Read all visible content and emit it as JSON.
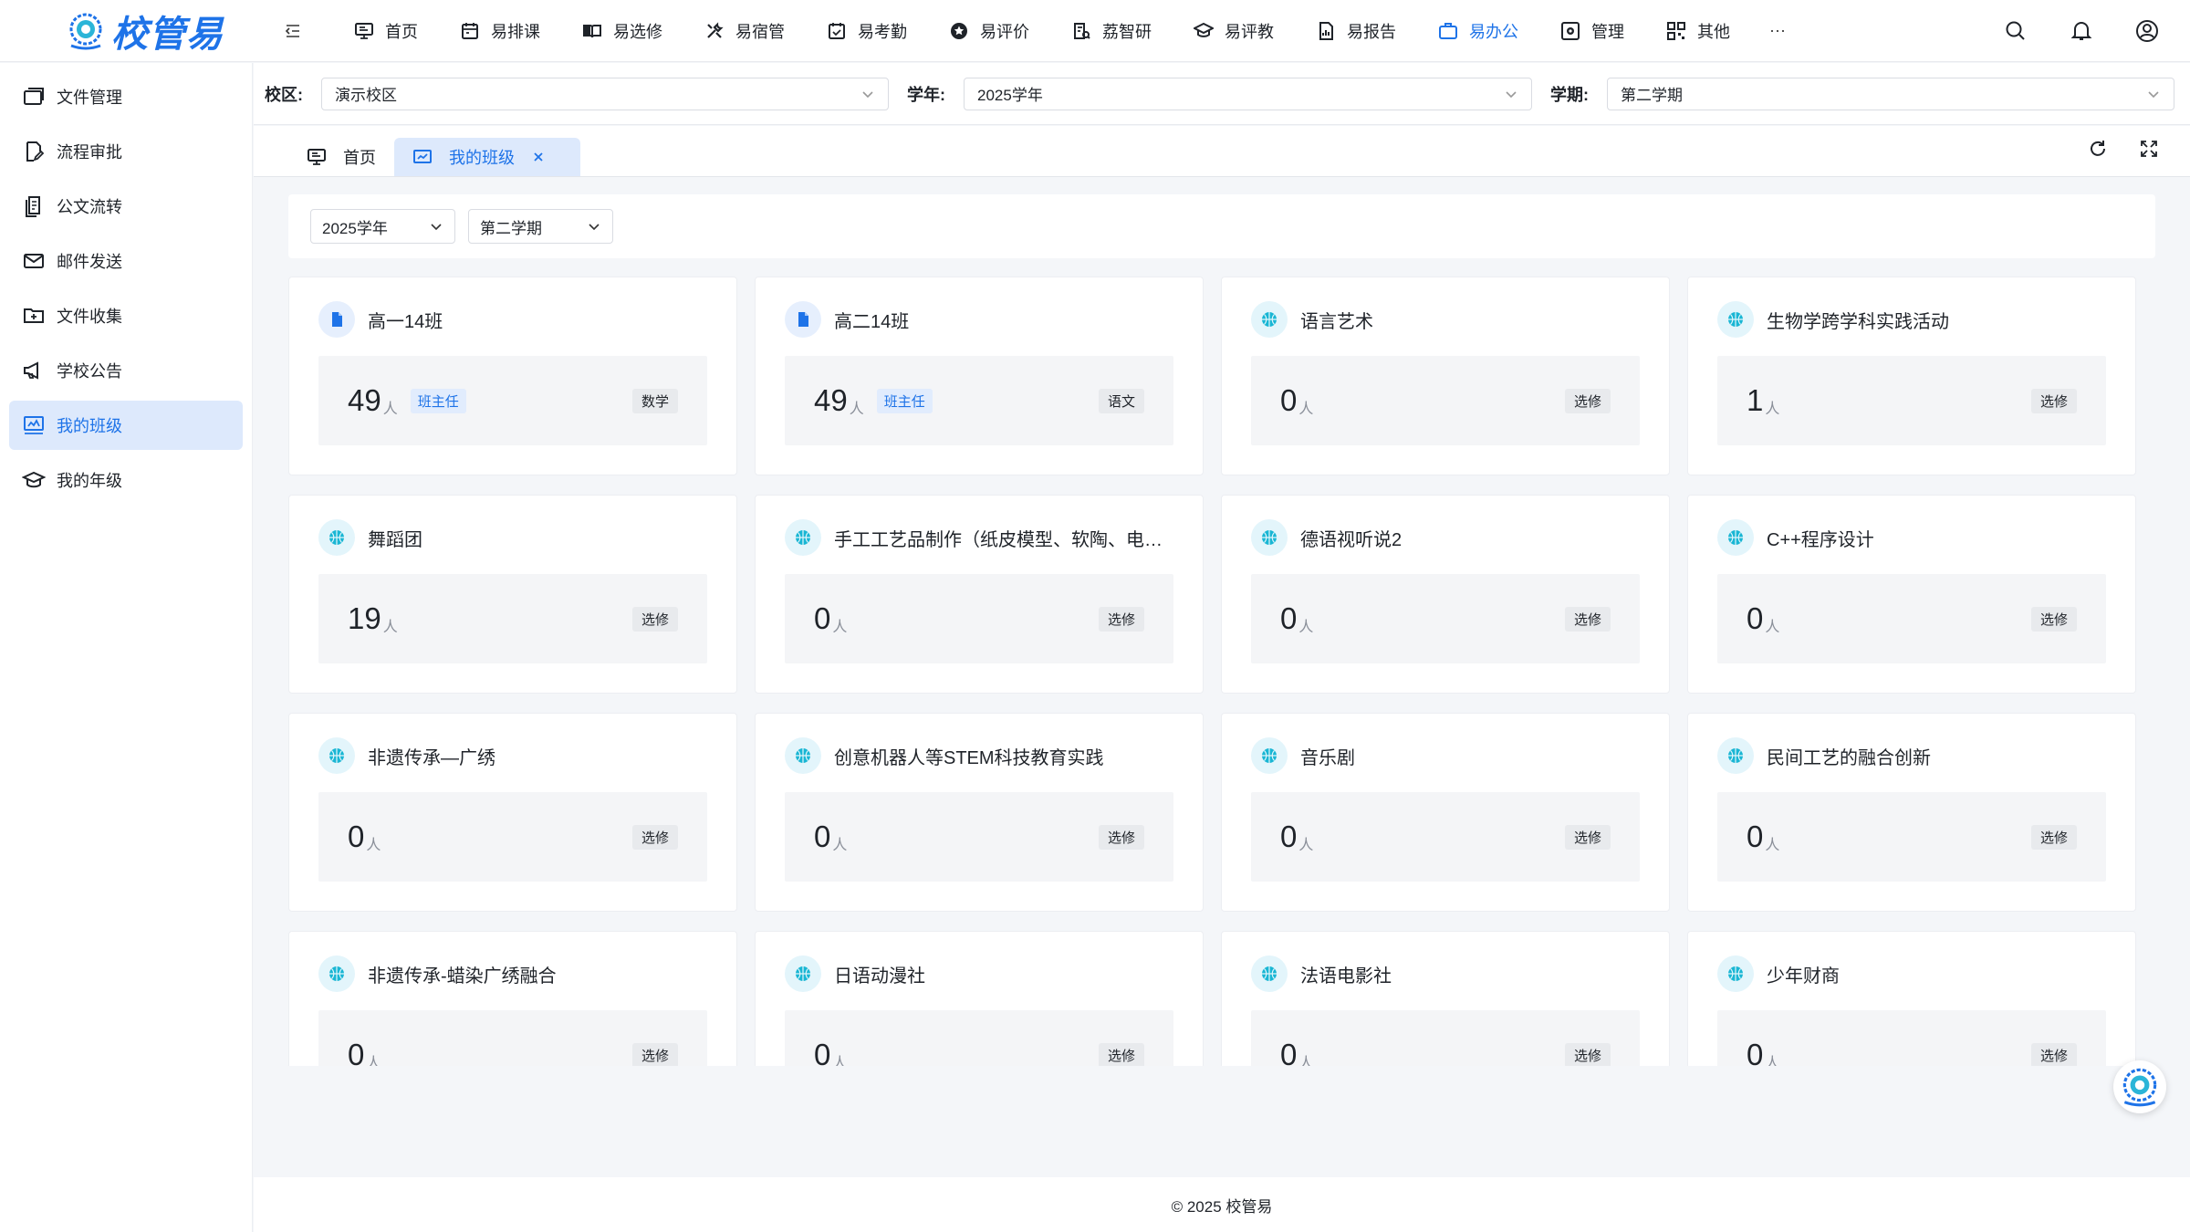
{
  "app": {
    "logo_text": "校管易"
  },
  "top_nav": {
    "items": [
      {
        "label": "首页",
        "icon": "monitor-icon"
      },
      {
        "label": "易排课",
        "icon": "calendar-icon"
      },
      {
        "label": "易选修",
        "icon": "book-icon"
      },
      {
        "label": "易宿管",
        "icon": "tools-icon"
      },
      {
        "label": "易考勤",
        "icon": "check-calendar-icon"
      },
      {
        "label": "易评价",
        "icon": "star-icon"
      },
      {
        "label": "荔智研",
        "icon": "research-icon"
      },
      {
        "label": "易评教",
        "icon": "graduation-cap-icon"
      },
      {
        "label": "易报告",
        "icon": "report-icon"
      },
      {
        "label": "易办公",
        "icon": "briefcase-icon"
      },
      {
        "label": "管理",
        "icon": "settings-box-icon"
      },
      {
        "label": "其他",
        "icon": "grid-icon"
      }
    ],
    "active": "易办公",
    "more": "···"
  },
  "sidebar": {
    "items": [
      {
        "label": "文件管理"
      },
      {
        "label": "流程审批"
      },
      {
        "label": "公文流转"
      },
      {
        "label": "邮件发送"
      },
      {
        "label": "文件收集"
      },
      {
        "label": "学校公告"
      },
      {
        "label": "我的班级"
      },
      {
        "label": "我的年级"
      }
    ],
    "active": "我的班级"
  },
  "filters": {
    "campus_label": "校区:",
    "campus_value": "演示校区",
    "year_label": "学年:",
    "year_value": "2025学年",
    "term_label": "学期:",
    "term_value": "第二学期"
  },
  "tabs": {
    "home": "首页",
    "current": "我的班级"
  },
  "panel": {
    "year": "2025学年",
    "term": "第二学期"
  },
  "unit": "人",
  "cards": [
    {
      "title": "高一14班",
      "count": "49",
      "role": "班主任",
      "tag": "数学",
      "icon": "doc"
    },
    {
      "title": "高二14班",
      "count": "49",
      "role": "班主任",
      "tag": "语文",
      "icon": "doc"
    },
    {
      "title": "语言艺术",
      "count": "0",
      "tag": "选修",
      "icon": "ball"
    },
    {
      "title": "生物学跨学科实践活动",
      "count": "1",
      "tag": "选修",
      "icon": "ball"
    },
    {
      "title": "舞蹈团",
      "count": "19",
      "tag": "选修",
      "icon": "ball"
    },
    {
      "title": "手工工艺品制作（纸皮模型、软陶、电…",
      "count": "0",
      "tag": "选修",
      "icon": "ball"
    },
    {
      "title": "德语视听说2",
      "count": "0",
      "tag": "选修",
      "icon": "ball"
    },
    {
      "title": "C++程序设计",
      "count": "0",
      "tag": "选修",
      "icon": "ball"
    },
    {
      "title": "非遗传承—广绣",
      "count": "0",
      "tag": "选修",
      "icon": "ball"
    },
    {
      "title": "创意机器人等STEM科技教育实践",
      "count": "0",
      "tag": "选修",
      "icon": "ball"
    },
    {
      "title": "音乐剧",
      "count": "0",
      "tag": "选修",
      "icon": "ball"
    },
    {
      "title": "民间工艺的融合创新",
      "count": "0",
      "tag": "选修",
      "icon": "ball"
    },
    {
      "title": "非遗传承-蜡染广绣融合",
      "count": "0",
      "tag": "选修",
      "icon": "ball"
    },
    {
      "title": "日语动漫社",
      "count": "0",
      "tag": "选修",
      "icon": "ball"
    },
    {
      "title": "法语电影社",
      "count": "0",
      "tag": "选修",
      "icon": "ball"
    },
    {
      "title": "少年财商",
      "count": "0",
      "tag": "选修",
      "icon": "ball"
    }
  ],
  "footer": "© 2025 校管易",
  "colors": {
    "accent": "#1e73e8",
    "active_bg": "#dde9fc",
    "teal": "#19b6d4"
  }
}
